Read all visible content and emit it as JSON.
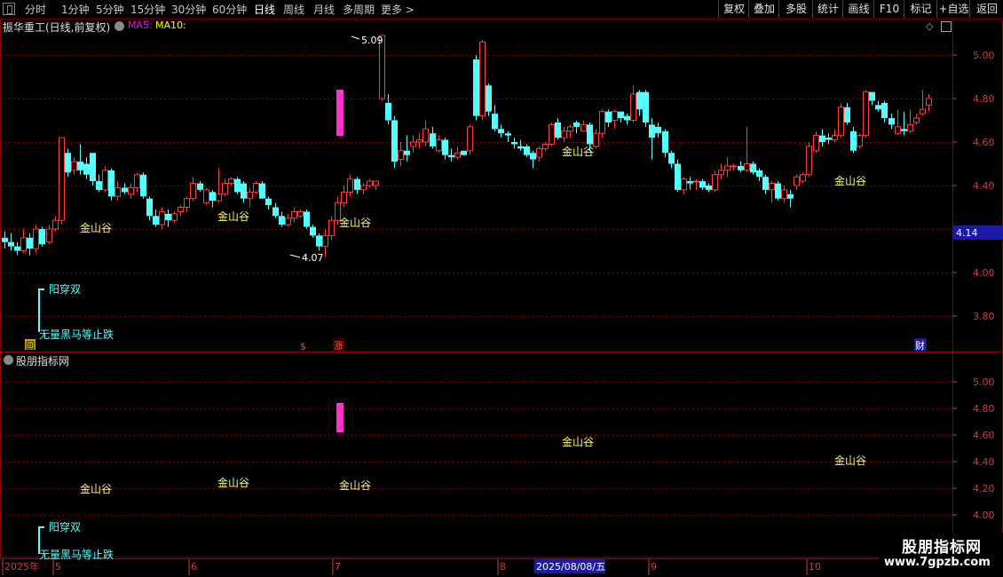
{
  "toolbar": {
    "periods": [
      "分时",
      "1分钟",
      "5分钟",
      "15分钟",
      "30分钟",
      "60分钟",
      "日线",
      "周线",
      "月线",
      "多周期",
      "更多 >"
    ],
    "active_period": "日线",
    "right_buttons": [
      "复权",
      "叠加",
      "多股",
      "统计",
      "画线",
      "F10",
      "标记",
      "+自选",
      "返回"
    ]
  },
  "main_panel": {
    "title": "振华重工(日线,前复权)",
    "ma5_label": "MA5:",
    "ma10_label": "MA10:",
    "price_ticks": [
      "5.00",
      "4.80",
      "4.60",
      "4.40",
      "4.00",
      "3.80"
    ],
    "current_price_tag": "4.14",
    "high_label": "5.09",
    "low_label": "4.07",
    "signal_labels": [
      "金山谷",
      "金山谷",
      "金山谷",
      "金山谷",
      "金山谷"
    ],
    "legend_line1": "阳穿双",
    "legend_line2": "无量黑马等止跌",
    "marker_s": "$",
    "marker_zhang": "涨",
    "marker_cai": "财",
    "marker_hui": "回"
  },
  "sub_panel": {
    "title": "股朋指标网",
    "price_ticks": [
      "5.00",
      "4.80",
      "4.60",
      "4.40",
      "4.20",
      "4.00"
    ],
    "signal_labels": [
      "金山谷",
      "金山谷",
      "金山谷",
      "金山谷",
      "金山谷"
    ],
    "legend_line1": "阳穿双",
    "legend_line2": "无量黑马等止跌"
  },
  "date_axis": {
    "labels": [
      "2025年",
      "5",
      "6",
      "7",
      "8",
      "9",
      "10"
    ],
    "cursor_date": "2025/08/08/五"
  },
  "watermark": {
    "title": "股朋指标网",
    "url": "www.7gpzb.com"
  },
  "colors": {
    "up": "#ff3c3c",
    "down": "#54ffff",
    "grid": "#8b0000",
    "axis_text": "#d23c3c",
    "ma5": "#ff00ff",
    "ma10": "#ffff00",
    "signal": "#ffff66",
    "marker_bar": "#ff33cc"
  },
  "chart_data": {
    "type": "candlestick",
    "title": "振华重工(日线,前复权)",
    "ylim": [
      3.7,
      5.1
    ],
    "y_ticks": [
      3.8,
      4.0,
      4.4,
      4.6,
      4.8,
      5.0
    ],
    "high": 5.09,
    "low": 4.07,
    "last_price": 4.14,
    "x_period_labels": [
      "2025年",
      "5",
      "6",
      "7",
      "8",
      "9",
      "10"
    ],
    "candles": [
      [
        4.16,
        4.14,
        4.19,
        4.11
      ],
      [
        4.14,
        4.12,
        4.18,
        4.1
      ],
      [
        4.12,
        4.1,
        4.14,
        4.08
      ],
      [
        4.1,
        4.16,
        4.2,
        4.09
      ],
      [
        4.16,
        4.11,
        4.18,
        4.08
      ],
      [
        4.11,
        4.2,
        4.22,
        4.09
      ],
      [
        4.2,
        4.13,
        4.21,
        4.12
      ],
      [
        4.14,
        4.2,
        4.22,
        4.13
      ],
      [
        4.2,
        4.24,
        4.26,
        4.19
      ],
      [
        4.24,
        4.62,
        4.62,
        4.22
      ],
      [
        4.55,
        4.46,
        4.57,
        4.44
      ],
      [
        4.47,
        4.51,
        4.53,
        4.45
      ],
      [
        4.51,
        4.47,
        4.59,
        4.45
      ],
      [
        4.5,
        4.45,
        4.53,
        4.43
      ],
      [
        4.55,
        4.42,
        4.55,
        4.4
      ],
      [
        4.42,
        4.38,
        4.45,
        4.37
      ],
      [
        4.38,
        4.47,
        4.49,
        4.37
      ],
      [
        4.47,
        4.35,
        4.48,
        4.33
      ],
      [
        4.35,
        4.39,
        4.42,
        4.33
      ],
      [
        4.39,
        4.37,
        4.41,
        4.36
      ],
      [
        4.36,
        4.39,
        4.41,
        4.34
      ],
      [
        4.39,
        4.45,
        4.46,
        4.37
      ],
      [
        4.45,
        4.35,
        4.46,
        4.34
      ],
      [
        4.34,
        4.26,
        4.35,
        4.24
      ],
      [
        4.26,
        4.22,
        4.29,
        4.21
      ],
      [
        4.22,
        4.28,
        4.3,
        4.2
      ],
      [
        4.27,
        4.24,
        4.29,
        4.21
      ],
      [
        4.24,
        4.27,
        4.28,
        4.23
      ],
      [
        4.28,
        4.3,
        4.31,
        4.26
      ],
      [
        4.3,
        4.34,
        4.35,
        4.28
      ],
      [
        4.34,
        4.41,
        4.44,
        4.33
      ],
      [
        4.41,
        4.38,
        4.42,
        4.37
      ],
      [
        4.32,
        4.38,
        4.39,
        4.31
      ],
      [
        4.37,
        4.33,
        4.38,
        4.3
      ],
      [
        4.33,
        4.36,
        4.48,
        4.32
      ],
      [
        4.36,
        4.41,
        4.43,
        4.35
      ],
      [
        4.41,
        4.43,
        4.44,
        4.4
      ],
      [
        4.43,
        4.37,
        4.44,
        4.36
      ],
      [
        4.41,
        4.34,
        4.42,
        4.32
      ],
      [
        4.34,
        4.37,
        4.39,
        4.3
      ],
      [
        4.37,
        4.41,
        4.42,
        4.36
      ],
      [
        4.41,
        4.34,
        4.42,
        4.34
      ],
      [
        4.34,
        4.31,
        4.35,
        4.29
      ],
      [
        4.3,
        4.26,
        4.32,
        4.25
      ],
      [
        4.26,
        4.22,
        4.28,
        4.21
      ],
      [
        4.22,
        4.25,
        4.27,
        4.21
      ],
      [
        4.25,
        4.28,
        4.3,
        4.23
      ],
      [
        4.26,
        4.28,
        4.29,
        4.25
      ],
      [
        4.28,
        4.21,
        4.29,
        4.2
      ],
      [
        4.21,
        4.17,
        4.22,
        4.16
      ],
      [
        4.17,
        4.12,
        4.18,
        4.1
      ],
      [
        4.12,
        4.17,
        4.2,
        4.07
      ],
      [
        4.17,
        4.24,
        4.26,
        4.15
      ],
      [
        4.24,
        4.32,
        4.35,
        4.22
      ],
      [
        4.32,
        4.37,
        4.4,
        4.3
      ],
      [
        4.37,
        4.43,
        4.45,
        4.35
      ],
      [
        4.43,
        4.38,
        4.44,
        4.36
      ],
      [
        4.38,
        4.4,
        4.41,
        4.36
      ],
      [
        4.4,
        4.42,
        4.43,
        4.39
      ],
      [
        4.4,
        4.42,
        4.42,
        4.38
      ],
      [
        4.8,
        5.09,
        5.09,
        4.79
      ],
      [
        4.78,
        4.7,
        4.82,
        4.68
      ],
      [
        4.7,
        4.51,
        4.72,
        4.48
      ],
      [
        4.52,
        4.56,
        4.6,
        4.49
      ],
      [
        4.56,
        4.54,
        4.63,
        4.51
      ],
      [
        4.58,
        4.6,
        4.63,
        4.55
      ],
      [
        4.6,
        4.61,
        4.64,
        4.57
      ],
      [
        4.6,
        4.66,
        4.7,
        4.58
      ],
      [
        4.64,
        4.58,
        4.67,
        4.57
      ],
      [
        4.56,
        4.61,
        4.63,
        4.55
      ],
      [
        4.61,
        4.54,
        4.62,
        4.52
      ],
      [
        4.54,
        4.53,
        4.57,
        4.51
      ],
      [
        4.53,
        4.55,
        4.58,
        4.52
      ],
      [
        4.56,
        4.54,
        4.56,
        4.54
      ],
      [
        4.56,
        4.67,
        4.68,
        4.54
      ],
      [
        4.98,
        4.72,
        5.0,
        4.7
      ],
      [
        4.72,
        5.06,
        5.07,
        4.7
      ],
      [
        4.86,
        4.74,
        4.87,
        4.72
      ],
      [
        4.73,
        4.66,
        4.77,
        4.65
      ],
      [
        4.66,
        4.64,
        4.68,
        4.62
      ],
      [
        4.64,
        4.63,
        4.65,
        4.6
      ],
      [
        4.6,
        4.59,
        4.62,
        4.57
      ],
      [
        4.58,
        4.57,
        4.61,
        4.56
      ],
      [
        4.58,
        4.54,
        4.59,
        4.53
      ],
      [
        4.55,
        4.52,
        4.56,
        4.48
      ],
      [
        4.53,
        4.57,
        4.58,
        4.51
      ],
      [
        4.57,
        4.59,
        4.6,
        4.56
      ],
      [
        4.59,
        4.68,
        4.69,
        4.58
      ],
      [
        4.69,
        4.62,
        4.71,
        4.61
      ],
      [
        4.62,
        4.65,
        4.67,
        4.6
      ],
      [
        4.65,
        4.67,
        4.68,
        4.62
      ],
      [
        4.69,
        4.67,
        4.7,
        4.64
      ],
      [
        4.65,
        4.68,
        4.7,
        4.66
      ],
      [
        4.68,
        4.59,
        4.69,
        4.56
      ],
      [
        4.58,
        4.64,
        4.66,
        4.57
      ],
      [
        4.64,
        4.74,
        4.75,
        4.62
      ],
      [
        4.74,
        4.69,
        4.75,
        4.67
      ],
      [
        4.7,
        4.74,
        4.75,
        4.66
      ],
      [
        4.74,
        4.71,
        4.74,
        4.69
      ],
      [
        4.72,
        4.7,
        4.73,
        4.68
      ],
      [
        4.7,
        4.82,
        4.86,
        4.69
      ],
      [
        4.83,
        4.75,
        4.84,
        4.72
      ],
      [
        4.83,
        4.69,
        4.84,
        4.67
      ],
      [
        4.68,
        4.62,
        4.71,
        4.52
      ],
      [
        4.67,
        4.64,
        4.69,
        4.62
      ],
      [
        4.65,
        4.55,
        4.66,
        4.53
      ],
      [
        4.55,
        4.5,
        4.56,
        4.48
      ],
      [
        4.5,
        4.38,
        4.52,
        4.37
      ],
      [
        4.38,
        4.43,
        4.44,
        4.36
      ],
      [
        4.42,
        4.41,
        4.44,
        4.38
      ],
      [
        4.42,
        4.42,
        4.43,
        4.38
      ],
      [
        4.42,
        4.39,
        4.43,
        4.38
      ],
      [
        4.4,
        4.38,
        4.41,
        4.37
      ],
      [
        4.38,
        4.45,
        4.47,
        4.37
      ],
      [
        4.45,
        4.47,
        4.5,
        4.43
      ],
      [
        4.47,
        4.49,
        4.53,
        4.44
      ],
      [
        4.49,
        4.49,
        4.5,
        4.47
      ],
      [
        4.49,
        4.47,
        4.51,
        4.46
      ],
      [
        4.47,
        4.5,
        4.67,
        4.46
      ],
      [
        4.5,
        4.46,
        4.51,
        4.45
      ],
      [
        4.47,
        4.44,
        4.48,
        4.42
      ],
      [
        4.44,
        4.38,
        4.45,
        4.36
      ],
      [
        4.38,
        4.41,
        4.42,
        4.32
      ],
      [
        4.41,
        4.34,
        4.42,
        4.33
      ],
      [
        4.34,
        4.38,
        4.4,
        4.32
      ],
      [
        4.36,
        4.34,
        4.38,
        4.3
      ],
      [
        4.4,
        4.44,
        4.45,
        4.38
      ],
      [
        4.42,
        4.45,
        4.46,
        4.41
      ],
      [
        4.45,
        4.58,
        4.6,
        4.44
      ],
      [
        4.56,
        4.63,
        4.65,
        4.55
      ],
      [
        4.63,
        4.6,
        4.66,
        4.58
      ],
      [
        4.62,
        4.61,
        4.64,
        4.59
      ],
      [
        4.61,
        4.63,
        4.66,
        4.6
      ],
      [
        4.63,
        4.76,
        4.78,
        4.62
      ],
      [
        4.76,
        4.69,
        4.78,
        4.68
      ],
      [
        4.65,
        4.56,
        4.67,
        4.55
      ],
      [
        4.58,
        4.63,
        4.64,
        4.57
      ],
      [
        4.63,
        4.83,
        4.84,
        4.62
      ],
      [
        4.83,
        4.79,
        4.83,
        4.77
      ],
      [
        4.77,
        4.75,
        4.79,
        4.74
      ],
      [
        4.78,
        4.71,
        4.79,
        4.69
      ],
      [
        4.71,
        4.68,
        4.73,
        4.66
      ],
      [
        4.64,
        4.67,
        4.75,
        4.63
      ],
      [
        4.66,
        4.65,
        4.74,
        4.63
      ],
      [
        4.65,
        4.68,
        4.75,
        4.64
      ],
      [
        4.69,
        4.71,
        4.73,
        4.68
      ],
      [
        4.73,
        4.75,
        4.84,
        4.72
      ],
      [
        4.77,
        4.8,
        4.82,
        4.74
      ]
    ]
  }
}
